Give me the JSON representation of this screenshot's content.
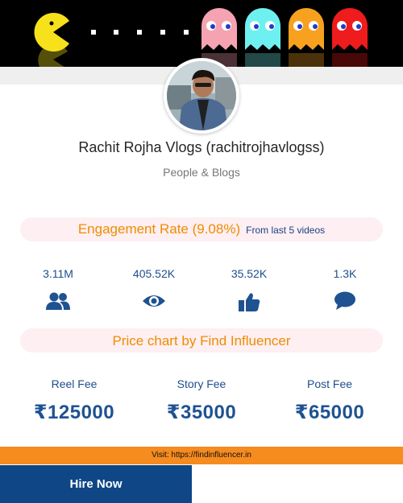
{
  "profile": {
    "name": "Rachit Rojha Vlogs (rachitrojhavlogss)",
    "category": "People & Blogs"
  },
  "engagement": {
    "title": "Engagement Rate (9.08%)",
    "subtitle": "From last 5 videos"
  },
  "stats": [
    {
      "value": "3.11M",
      "icon": "users-icon"
    },
    {
      "value": "405.52K",
      "icon": "eye-icon"
    },
    {
      "value": "35.52K",
      "icon": "thumbs-up-icon"
    },
    {
      "value": "1.3K",
      "icon": "comment-icon"
    }
  ],
  "price_chart": {
    "title": "Price chart by Find Influencer",
    "fees": [
      {
        "label": "Reel Fee",
        "amount": "₹125000"
      },
      {
        "label": "Story Fee",
        "amount": "₹35000"
      },
      {
        "label": "Post Fee",
        "amount": "₹65000"
      }
    ]
  },
  "footer": {
    "visit_text": "Visit: https://findinfluencer.in",
    "hire_label": "Hire Now"
  },
  "colors": {
    "accent_orange": "#f08c00",
    "brand_blue": "#1e4e8c",
    "pill_bg": "#fdeff2",
    "footer_orange": "#f68b1f",
    "button_blue": "#0e4686"
  }
}
